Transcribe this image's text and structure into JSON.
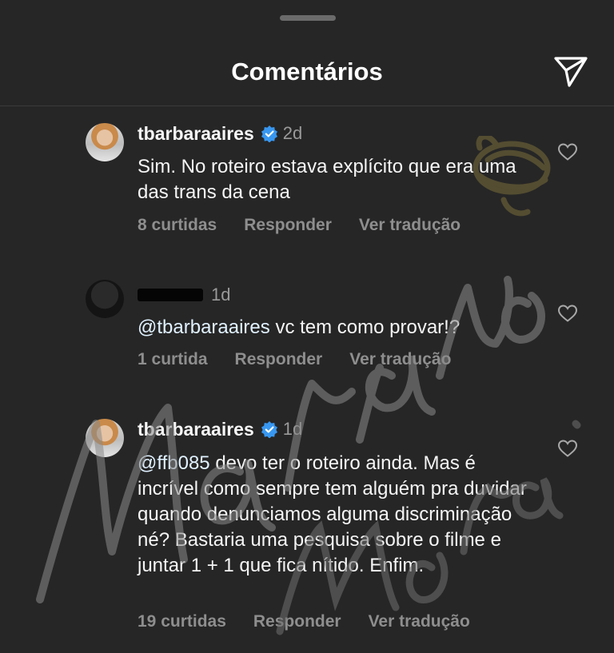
{
  "header": {
    "title": "Comentários"
  },
  "comments": [
    {
      "username": "tbarbaraaires",
      "time": "2d",
      "text": "Sim. No roteiro estava explícito que era uma das trans da cena",
      "likes": "8 curtidas",
      "reply": "Responder",
      "translate": "Ver tradução"
    },
    {
      "time": "1d",
      "mention": "@tbarbaraaires",
      "text": " vc tem como provar!?",
      "likes": "1 curtida",
      "reply": "Responder",
      "translate": "Ver tradução"
    },
    {
      "username": "tbarbaraaires",
      "time": "1d",
      "mention": "@ffb085",
      "text": " devo ter o roteiro ainda. Mas é incrível como sempre tem alguém pra duvidar quando denunciamos alguma discriminação né? Bastaria uma pesquisa sobre o filme e juntar 1 + 1 que fica nítido. Enfim.",
      "likes": "19 curtidas",
      "reply": "Responder",
      "translate": "Ver tradução"
    }
  ],
  "colors": {
    "background": "#262626",
    "verified": "#3897f0",
    "muted": "#8e8e8e",
    "watermark": "#7a6d3a"
  },
  "icons": [
    "send-icon",
    "verified-badge-icon",
    "heart-icon"
  ]
}
